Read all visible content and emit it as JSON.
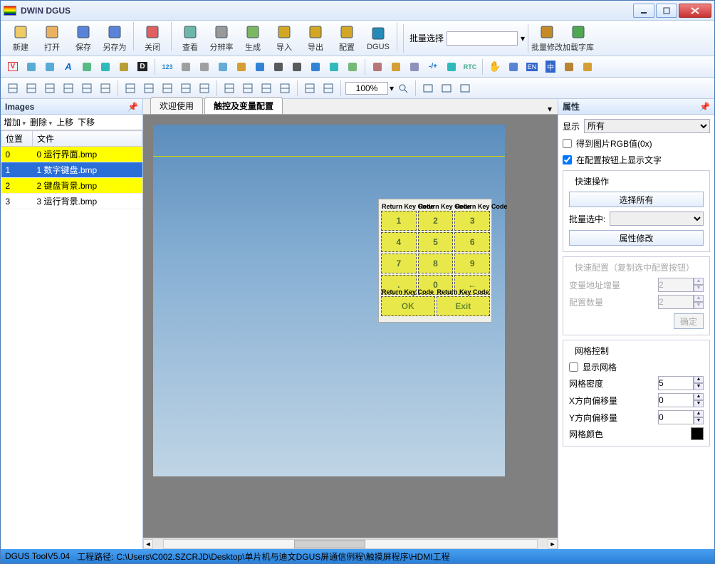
{
  "app": {
    "title": "DWIN DGUS"
  },
  "window_buttons": {
    "min": "–",
    "max": "□",
    "close": "×"
  },
  "toolbar": {
    "items": [
      {
        "label": "新建",
        "icon": "new"
      },
      {
        "label": "打开",
        "icon": "open"
      },
      {
        "label": "保存",
        "icon": "save"
      },
      {
        "label": "另存为",
        "icon": "saveas"
      },
      {
        "label": "关闭",
        "icon": "close"
      },
      {
        "label": "查看",
        "icon": "view"
      },
      {
        "label": "分辨率",
        "icon": "res"
      },
      {
        "label": "生成",
        "icon": "gen"
      },
      {
        "label": "导入",
        "icon": "import"
      },
      {
        "label": "导出",
        "icon": "export"
      },
      {
        "label": "配置",
        "icon": "config"
      },
      {
        "label": "DGUS",
        "icon": "dgus"
      }
    ],
    "batch_sel_label": "批量选择",
    "items2": [
      {
        "label": "批量修改",
        "icon": "batch"
      },
      {
        "label": "加载字库",
        "icon": "font"
      }
    ]
  },
  "toolbar2": {
    "icons": [
      "V",
      "copy",
      "flip",
      "A",
      "image",
      "refresh",
      "history",
      "D",
      "123",
      "var",
      "text",
      "rect",
      "ellipse",
      "wave",
      "line",
      "dash",
      "list",
      "circles",
      "check",
      "pen",
      "pencil",
      "mark",
      "plus-minus",
      "sync",
      "RTC",
      "hand",
      "grid",
      "EN",
      "中",
      "tools",
      "window"
    ]
  },
  "toolbar3": {
    "icons": [
      "align-l",
      "align-c",
      "align-r",
      "align-t",
      "align-m",
      "align-b",
      "dist-h",
      "dist-v",
      "same-w",
      "same-h",
      "same",
      "copy2",
      "paste",
      "clone",
      "del",
      "undo",
      "redo"
    ],
    "zoom": "100%",
    "icons2": [
      "fit",
      "screens",
      "single"
    ]
  },
  "images_panel": {
    "title": "Images",
    "ops": [
      "增加",
      "删除",
      "上移",
      "下移"
    ],
    "columns": [
      "位置",
      "文件"
    ],
    "rows": [
      {
        "pos": "0",
        "file": "0 运行界面.bmp",
        "cls": "y"
      },
      {
        "pos": "1",
        "file": "1 数字键盘.bmp",
        "cls": "sel"
      },
      {
        "pos": "2",
        "file": "2 键盘背景.bmp",
        "cls": "y"
      },
      {
        "pos": "3",
        "file": "3 运行背景.bmp",
        "cls": ""
      }
    ]
  },
  "tabs": {
    "welcome": "欢迎使用",
    "config": "触控及变量配置"
  },
  "keypad": {
    "ann": "Return Key Code",
    "rows": [
      [
        "1",
        "2",
        "3"
      ],
      [
        "4",
        "5",
        "6"
      ],
      [
        "7",
        "8",
        "9"
      ],
      [
        ".",
        "0",
        "←"
      ]
    ],
    "bottom": [
      "OK",
      "Exit"
    ]
  },
  "props": {
    "title": "属性",
    "display_label": "显示",
    "display_value": "所有",
    "chk_rgb": "得到图片RGB值(0x)",
    "chk_showtext": "在配置按钮上显示文字",
    "quick": {
      "title": "快速操作",
      "select_all": "选择所有",
      "batch_sel_label": "批量选中:",
      "modify": "属性修改"
    },
    "quickcfg": {
      "title": "快速配置（复制选中配置按钮）",
      "addr_label": "变量地址增量",
      "addr_value": "2",
      "count_label": "配置数量",
      "count_value": "2",
      "ok": "确定"
    },
    "grid": {
      "title": "网格控制",
      "show": "显示网格",
      "density_label": "网格密度",
      "density_value": "5",
      "x_label": "X方向偏移量",
      "x_value": "0",
      "y_label": "Y方向偏移量",
      "y_value": "0",
      "color_label": "网格颜色"
    }
  },
  "status": {
    "tool": "DGUS ToolV5.04",
    "path_label": "工程路径:",
    "path": "C:\\Users\\C002.SZCRJD\\Desktop\\单片机与迪文DGUS屏通信例程\\触摸屏程序\\HDMI工程"
  }
}
